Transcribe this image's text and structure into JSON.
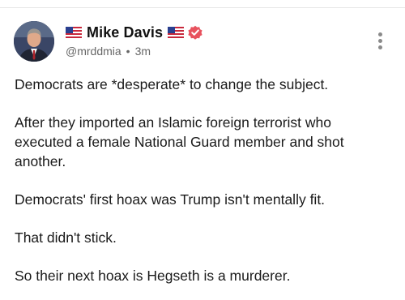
{
  "post": {
    "author": {
      "display_name": "Mike Davis",
      "handle": "@mrddmia",
      "verified": true,
      "flag_icon": "us-flag-icon"
    },
    "timestamp": "3m",
    "separator": "•",
    "paragraphs": [
      "Democrats are *desperate* to change the subject.",
      "After they imported an Islamic foreign terrorist who executed a female National Guard member and shot another.",
      "Democrats' first hoax was Trump isn't mentally fit.",
      "That didn't stick.",
      "So their next hoax is Hegseth is a murderer."
    ]
  },
  "colors": {
    "verified_badge": "#e8525e",
    "meta_text": "#666666",
    "body_text": "#1a1a1a"
  }
}
